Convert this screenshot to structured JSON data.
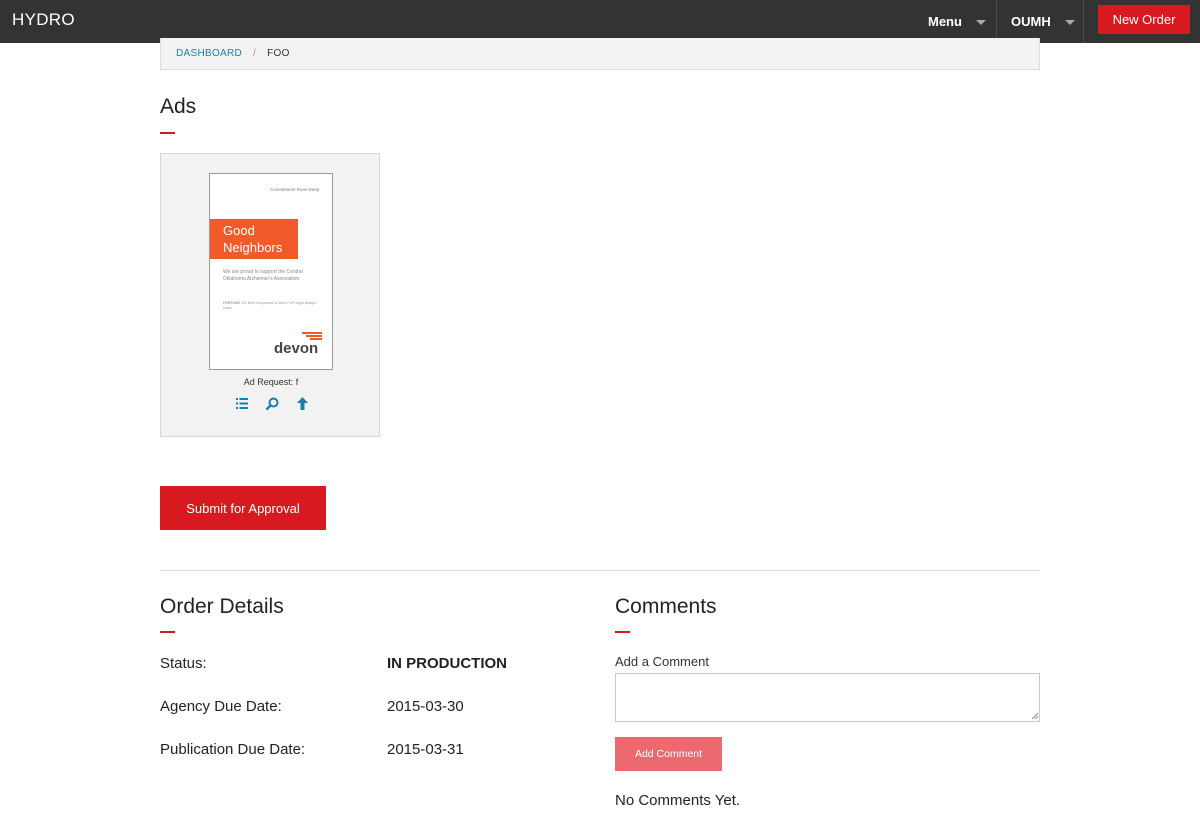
{
  "app": {
    "brand": "HYDRO"
  },
  "nav": {
    "menu_label": "Menu",
    "account_label": "OUMH",
    "new_order_label": "New Order"
  },
  "breadcrumb": {
    "items": [
      {
        "label": "DASHBOARD"
      },
      {
        "label": "FOO"
      }
    ],
    "separator": "/"
  },
  "ads": {
    "title": "Ads",
    "items": [
      {
        "caption": "Ad Request: f",
        "thumbnail": {
          "tagline": "Commitment Runs Deep",
          "headline": [
            "Good",
            "Neighbors"
          ],
          "body": "We are proud to support the Central Oklahoma Alzheimer's Association.",
          "fine_print_bold": "FORTUNE",
          "fine_print": "100 Best Companies to Work For® eight straight years",
          "logo": "devon"
        },
        "icons": [
          "list-icon",
          "search-icon",
          "upload-icon"
        ]
      }
    ],
    "submit_label": "Submit for Approval"
  },
  "order_details": {
    "title": "Order Details",
    "fields": [
      {
        "label": "Status:",
        "value": "IN PRODUCTION"
      },
      {
        "label": "Agency Due Date:",
        "value": "2015-03-30"
      },
      {
        "label": "Publication Due Date:",
        "value": "2015-03-31"
      }
    ]
  },
  "comments": {
    "title": "Comments",
    "add_label": "Add a Comment",
    "input_value": "",
    "button_label": "Add Comment",
    "empty_text": "No Comments Yet."
  },
  "colors": {
    "topbar": "#333333",
    "accent_red": "#d71920",
    "button_disabled_red": "#ec6a6f",
    "link_blue": "#1a7fa8",
    "ad_orange": "#f15a29"
  }
}
